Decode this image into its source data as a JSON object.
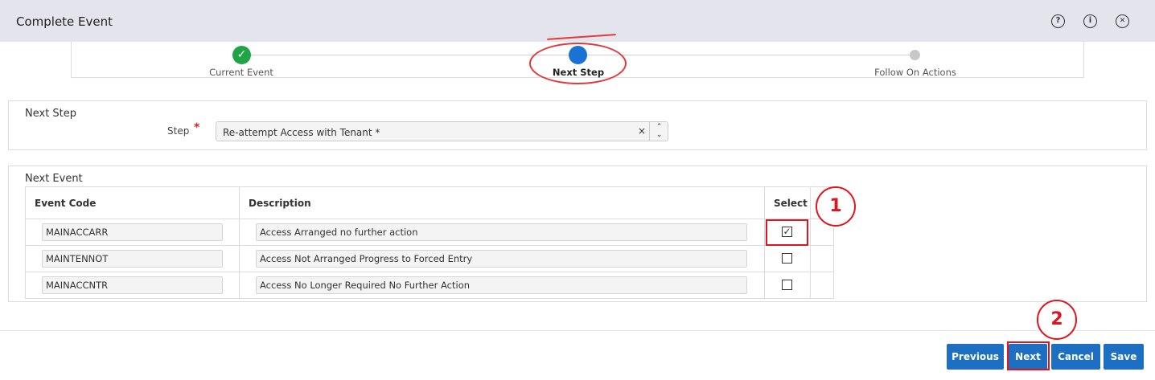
{
  "window": {
    "title": "Complete Event",
    "icons": [
      "help-icon",
      "info-icon",
      "close-icon"
    ],
    "help_glyph": "?",
    "info_glyph": "i",
    "close_glyph": "✕"
  },
  "train": {
    "stops": [
      {
        "label": "Current Event",
        "state": "completed"
      },
      {
        "label": "Next Step",
        "state": "active"
      },
      {
        "label": "Follow On Actions",
        "state": "pending"
      }
    ],
    "check_glyph": "✓"
  },
  "next_step": {
    "section_title": "Next Step",
    "step_label": "Step",
    "required_marker": "*",
    "step_value": "Re-attempt Access with Tenant *",
    "clear_glyph": "×",
    "spinner_glyph_up": "⌃",
    "spinner_glyph_down": "⌄"
  },
  "next_event": {
    "section_title": "Next Event",
    "columns": [
      "Event Code",
      "Description",
      "Select"
    ],
    "rows": [
      {
        "code": "MAINACCARR",
        "description": "Access Arranged no further action",
        "selected": true
      },
      {
        "code": "MAINTENNOT",
        "description": "Access Not Arranged Progress to Forced Entry",
        "selected": false
      },
      {
        "code": "MAINACCNTR",
        "description": "Access No Longer Required No Further Action",
        "selected": false
      }
    ],
    "checked_glyph": "✓"
  },
  "annotations": {
    "callout_1": "1",
    "callout_2": "2",
    "color": "#e0141e"
  },
  "footer": {
    "previous_label": "Previous",
    "next_label": "Next",
    "cancel_label": "Cancel",
    "save_label": "Save",
    "button_color": "#1d6fc2"
  },
  "colors": {
    "completed": "#1fa545",
    "active": "#1a73d4",
    "pending": "#c8c8c8"
  }
}
